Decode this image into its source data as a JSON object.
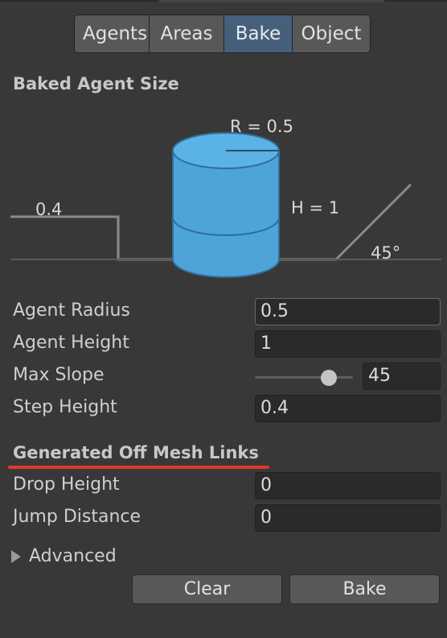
{
  "tabs": [
    {
      "label": "Agents",
      "active": false
    },
    {
      "label": "Areas",
      "active": false
    },
    {
      "label": "Bake",
      "active": true
    },
    {
      "label": "Object",
      "active": false
    }
  ],
  "baked_agent_size": {
    "title": "Baked Agent Size",
    "diagram": {
      "radius_label": "R = 0.5",
      "height_label": "H = 1",
      "step_label": "0.4",
      "slope_label": "45°",
      "cylinder_color": "#4ea3d9"
    }
  },
  "fields": {
    "agent_radius": {
      "label": "Agent Radius",
      "value": "0.5"
    },
    "agent_height": {
      "label": "Agent Height",
      "value": "1"
    },
    "max_slope": {
      "label": "Max Slope",
      "value": "45"
    },
    "step_height": {
      "label": "Step Height",
      "value": "0.4"
    }
  },
  "off_mesh": {
    "title": "Generated Off Mesh Links",
    "drop_height": {
      "label": "Drop Height",
      "value": "0"
    },
    "jump_distance": {
      "label": "Jump Distance",
      "value": "0"
    }
  },
  "advanced": {
    "label": "Advanced"
  },
  "buttons": {
    "clear": "Clear",
    "bake": "Bake"
  },
  "colors": {
    "accent_underline": "#e2392a",
    "active_tab": "#46607c"
  }
}
